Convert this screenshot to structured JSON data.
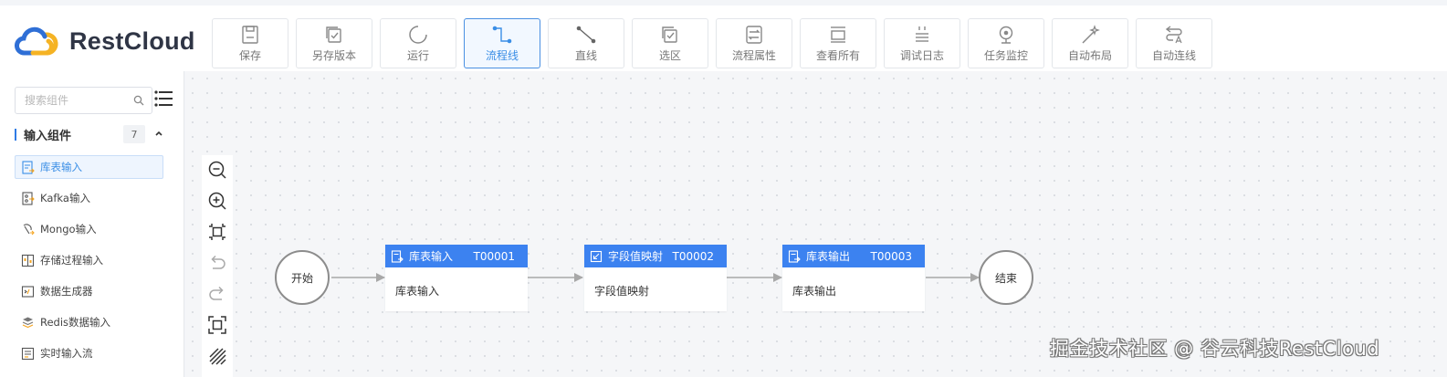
{
  "app": {
    "name": "RestCloud"
  },
  "toolbar": {
    "buttons": [
      {
        "label": "保存",
        "icon": "save-icon"
      },
      {
        "label": "另存版本",
        "icon": "save-version-icon"
      },
      {
        "label": "运行",
        "icon": "run-icon"
      },
      {
        "label": "流程线",
        "icon": "flow-line-icon",
        "active": true
      },
      {
        "label": "直线",
        "icon": "straight-line-icon"
      },
      {
        "label": "选区",
        "icon": "selection-icon"
      },
      {
        "label": "流程属性",
        "icon": "flow-properties-icon"
      },
      {
        "label": "查看所有",
        "icon": "view-all-icon"
      },
      {
        "label": "调试日志",
        "icon": "debug-log-icon"
      },
      {
        "label": "任务监控",
        "icon": "task-monitor-icon"
      },
      {
        "label": "自动布局",
        "icon": "auto-layout-icon"
      },
      {
        "label": "自动连线",
        "icon": "auto-connect-icon"
      }
    ]
  },
  "sidebar": {
    "search": {
      "placeholder": "搜索组件"
    },
    "group": {
      "title": "输入组件",
      "count": "7"
    },
    "items": [
      {
        "label": "库表输入",
        "active": true
      },
      {
        "label": "Kafka输入"
      },
      {
        "label": "Mongo输入"
      },
      {
        "label": "存储过程输入"
      },
      {
        "label": "数据生成器"
      },
      {
        "label": "Redis数据输入"
      },
      {
        "label": "实时输入流"
      }
    ]
  },
  "canvas": {
    "start": {
      "label": "开始"
    },
    "end": {
      "label": "结束"
    },
    "nodes": [
      {
        "title": "库表输入",
        "id": "T00001",
        "body": "库表输入",
        "icon": "table-input-icon"
      },
      {
        "title": "字段值映射",
        "id": "T00002",
        "body": "字段值映射",
        "icon": "field-mapping-icon"
      },
      {
        "title": "库表输出",
        "id": "T00003",
        "body": "库表输出",
        "icon": "table-output-icon"
      }
    ]
  },
  "colors": {
    "accent": "#3c82f0",
    "active_text": "#3a8ee6",
    "edge": "#a8a8a8"
  },
  "watermark": "掘金技术社区 @ 谷云科技RestCloud"
}
